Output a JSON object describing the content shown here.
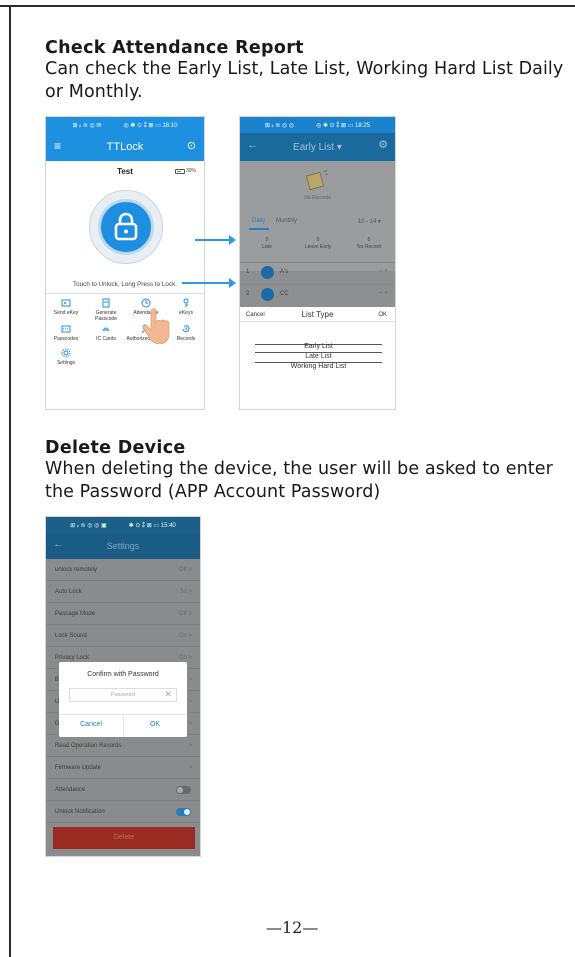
{
  "section1": {
    "title": "Check Attendance Report",
    "body": "Can check the Early List, Late List, Working Hard List Daily or Monthly."
  },
  "section2": {
    "title": "Delete Device",
    "body": "When deleting the device, the user will be asked to enter the Password (APP Account Password)"
  },
  "page_number": "—12—",
  "colors": {
    "accent": "#1e90e0",
    "danger": "#9a2b22",
    "arrow": "#2a9be8"
  },
  "phone1": {
    "status_time": "16:10",
    "status_signal": "⊞ ᵢₗ ≋ ◎ ✉",
    "status_right": "◎ ✱ ⊙ ⁑ ⊠ ▭ 16:10",
    "app_title": "TTLock",
    "lock_name": "Test",
    "battery": "30%",
    "touch_text": "Touch to Unlock, Long Press to Lock.",
    "menu": [
      {
        "label": "Send eKey",
        "icon": "send-ekey-icon"
      },
      {
        "label": "Generate Passcode",
        "icon": "passcode-generate-icon"
      },
      {
        "label": "Attendance",
        "icon": "attendance-icon"
      },
      {
        "label": "eKeys",
        "icon": "ekeys-icon"
      },
      {
        "label": "Passcodes",
        "icon": "passcodes-icon"
      },
      {
        "label": "IC Cards",
        "icon": "ic-card-icon"
      },
      {
        "label": "Authorized Admin",
        "icon": "admin-icon"
      },
      {
        "label": "Records",
        "icon": "records-icon"
      },
      {
        "label": "Settings",
        "icon": "settings-icon"
      }
    ]
  },
  "phone2": {
    "status_left": "⊞ ᵢₗ ≋ ◎ ◎",
    "status_right": "◎ ✱ ⊙ ⁑ ⊠ ▭ 18:25",
    "title": "Early List ▾",
    "no_records": "No Records",
    "tabs": {
      "daily": "Daily",
      "monthly": "Monthly",
      "date": "10 - 14 ▾"
    },
    "stats": [
      {
        "value": "0",
        "label": "Late"
      },
      {
        "value": "0",
        "label": "Leave Early"
      },
      {
        "value": "0",
        "label": "No Record"
      }
    ],
    "rows": [
      {
        "num": "1",
        "name": "A's",
        "value": "-"
      },
      {
        "num": "2",
        "name": "CC",
        "value": "-"
      }
    ],
    "sheet": {
      "cancel": "Cancel",
      "title": "List Type",
      "ok": "OK",
      "options": [
        "Early List",
        "Late List",
        "Working Hard List"
      ]
    }
  },
  "phone3": {
    "status_left": "⊞ ᵢₗ ≋ ◎ ◎ ▣",
    "status_right": "✱ ⊙ ⁑ ⊠ ▭ 15:40",
    "title": "Settings",
    "rows": [
      {
        "label": "unlock remotely",
        "value": "Off >"
      },
      {
        "label": "Auto Lock",
        "value": "5s >"
      },
      {
        "label": "Passage Mode",
        "value": "Off >"
      },
      {
        "label": "Lock Sound",
        "value": "On >"
      },
      {
        "label": "Privacy Lock",
        "value": "On >"
      },
      {
        "label": "B",
        "value": ">"
      },
      {
        "label": "U",
        "value": ">"
      },
      {
        "label": "D",
        "value": ">"
      },
      {
        "label": "Read Operation Records",
        "value": ">"
      },
      {
        "label": "Firmware Update",
        "value": ">"
      }
    ],
    "attendance_label": "Attendance",
    "attendance_on": false,
    "notification_label": "Unlock Notification",
    "notification_on": true,
    "delete_label": "Delete",
    "dialog": {
      "title": "Confirm with Password",
      "placeholder": "Password",
      "cancel": "Cancel",
      "ok": "OK"
    }
  }
}
